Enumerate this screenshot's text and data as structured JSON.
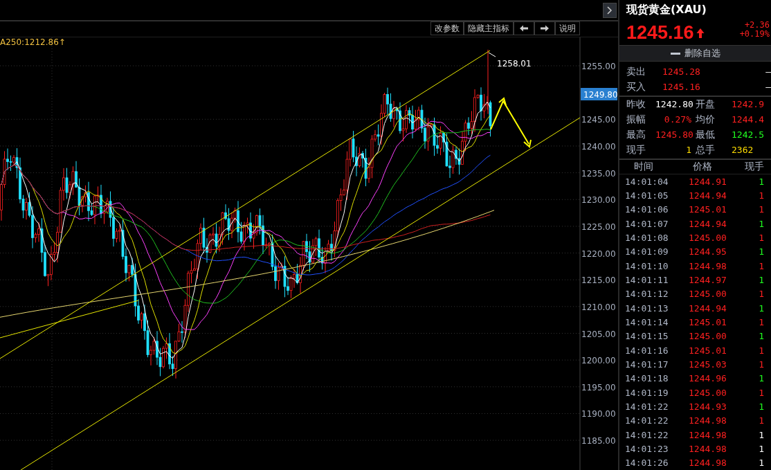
{
  "toolbar": [
    {
      "kind": "text",
      "label": "改参数"
    },
    {
      "kind": "text",
      "label": "隐藏主指标"
    },
    {
      "kind": "left"
    },
    {
      "kind": "right"
    },
    {
      "kind": "text",
      "label": "说明"
    }
  ],
  "chart": {
    "indicator_label": "A250:1212.86↑",
    "peak_label": "1258.01",
    "price_tag": "1249.80",
    "y_ticks": [
      "1255.00",
      "1245.00",
      "1240.00",
      "1235.00",
      "1230.00",
      "1225.00",
      "1220.00",
      "1215.00",
      "1210.00",
      "1205.00",
      "1200.00",
      "1195.00",
      "1190.00",
      "1185.00"
    ]
  },
  "quote": {
    "title": "现货黄金(XAU)",
    "price": "1245.16",
    "rising": true,
    "change": "+2.36",
    "change_pct": "+0.19%",
    "watch_button": "删除自选"
  },
  "bid_ask": [
    {
      "label": "卖出",
      "value": "1245.28",
      "extra": "—"
    },
    {
      "label": "买入",
      "value": "1245.16",
      "extra": "—"
    }
  ],
  "stats": [
    {
      "label": "昨收",
      "value": "1242.80",
      "color": "#ffffff"
    },
    {
      "label": "开盘",
      "value": "1242.9",
      "color": "#ff2020"
    },
    {
      "label": "振幅",
      "value": "0.27%",
      "color": "#ff2020"
    },
    {
      "label": "均价",
      "value": "1244.4",
      "color": "#ff2020"
    },
    {
      "label": "最高",
      "value": "1245.80",
      "color": "#ff2020"
    },
    {
      "label": "最低",
      "value": "1242.5",
      "color": "#20ff20"
    },
    {
      "label": "现手",
      "value": "1",
      "color": "#ffdd00"
    },
    {
      "label": "总手",
      "value": "2362",
      "color": "#ffdd00"
    }
  ],
  "ticks_table": {
    "columns": [
      "时间",
      "价格",
      "现手"
    ],
    "rows": [
      {
        "time": "14:01:04",
        "price": "1244.91",
        "volume": "1",
        "color": "#20ff20"
      },
      {
        "time": "14:01:05",
        "price": "1244.94",
        "volume": "1",
        "color": "#ff2020"
      },
      {
        "time": "14:01:06",
        "price": "1245.01",
        "volume": "1",
        "color": "#ff2020"
      },
      {
        "time": "14:01:07",
        "price": "1244.94",
        "volume": "1",
        "color": "#20ff20"
      },
      {
        "time": "14:01:08",
        "price": "1245.00",
        "volume": "1",
        "color": "#ff2020"
      },
      {
        "time": "14:01:09",
        "price": "1244.95",
        "volume": "1",
        "color": "#20ff20"
      },
      {
        "time": "14:01:10",
        "price": "1244.98",
        "volume": "1",
        "color": "#ff2020"
      },
      {
        "time": "14:01:11",
        "price": "1244.97",
        "volume": "1",
        "color": "#20ff20"
      },
      {
        "time": "14:01:12",
        "price": "1245.00",
        "volume": "1",
        "color": "#ff2020"
      },
      {
        "time": "14:01:13",
        "price": "1244.94",
        "volume": "1",
        "color": "#20ff20"
      },
      {
        "time": "14:01:14",
        "price": "1245.01",
        "volume": "1",
        "color": "#ff2020"
      },
      {
        "time": "14:01:15",
        "price": "1245.00",
        "volume": "1",
        "color": "#20ff20"
      },
      {
        "time": "14:01:16",
        "price": "1245.01",
        "volume": "1",
        "color": "#ff2020"
      },
      {
        "time": "14:01:17",
        "price": "1245.03",
        "volume": "1",
        "color": "#ff2020"
      },
      {
        "time": "14:01:18",
        "price": "1244.96",
        "volume": "1",
        "color": "#20ff20"
      },
      {
        "time": "14:01:19",
        "price": "1245.00",
        "volume": "1",
        "color": "#ff2020"
      },
      {
        "time": "14:01:22",
        "price": "1244.93",
        "volume": "1",
        "color": "#20ff20"
      },
      {
        "time": "14:01:22",
        "price": "1244.98",
        "volume": "1",
        "color": "#ff2020"
      },
      {
        "time": "14:01:22",
        "price": "1244.98",
        "volume": "1",
        "color": "#ffffff"
      },
      {
        "time": "14:01:23",
        "price": "1244.98",
        "volume": "1",
        "color": "#ffffff"
      },
      {
        "time": "14:01:26",
        "price": "1244.98",
        "volume": "1",
        "color": "#ffffff"
      }
    ]
  }
}
